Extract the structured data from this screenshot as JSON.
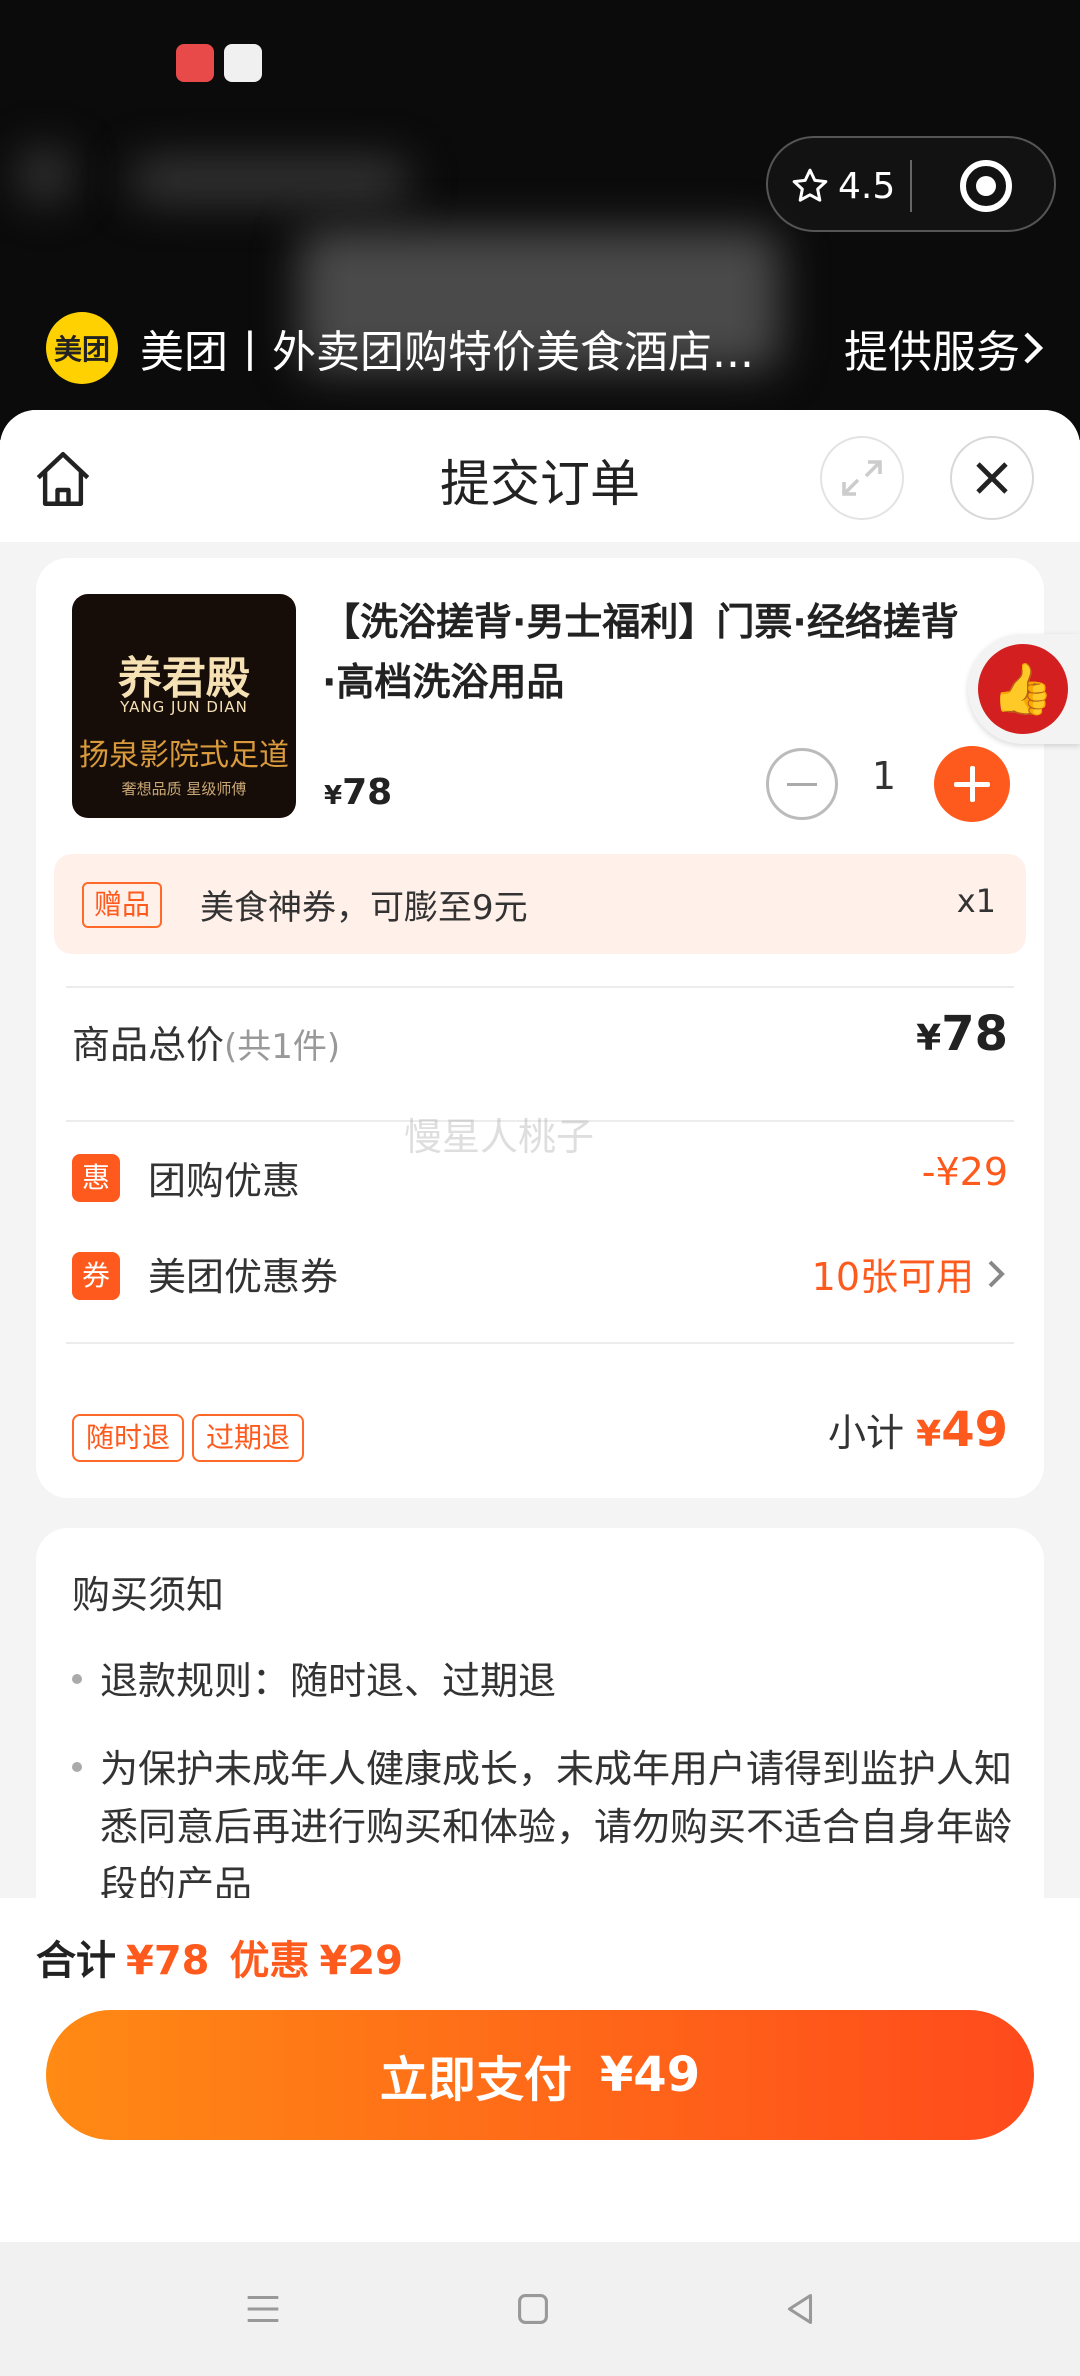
{
  "mini_app": {
    "rating": "4.5",
    "logo_text": "美团",
    "service_name": "美团丨外卖团购特价美食酒店...",
    "service_link": "提供服务"
  },
  "header": {
    "title": "提交订单"
  },
  "product": {
    "image_text_1": "养君殿",
    "image_text_2": "YANG JUN DIAN",
    "image_text_3": "扬泉影院式足道",
    "image_text_4": "奢想品质 星级师傅",
    "title": "【洗浴搓背·男士福利】门票·经络搓背·高档洗浴用品",
    "price_symbol": "¥",
    "price": "78",
    "quantity": "1"
  },
  "gift": {
    "tag": "赠品",
    "text": "美食神券，可膨至9元",
    "count": "x1"
  },
  "totals": {
    "goods_label": "商品总价",
    "goods_sub": "(共1件)",
    "goods_symbol": "¥",
    "goods_value": "78",
    "group_icon": "惠",
    "group_label": "团购优惠",
    "group_value": "-¥29",
    "coupon_icon": "券",
    "coupon_label": "美团优惠券",
    "coupon_value": "10张可用",
    "policy_tags": [
      "随时退",
      "过期退"
    ],
    "subtotal_label": "小计",
    "subtotal_symbol": "¥",
    "subtotal_value": "49"
  },
  "watermark": "慢星人桃子",
  "notice": {
    "title": "购买须知",
    "items": [
      "退款规则：随时退、过期退",
      "为保护未成年人健康成长，未成年用户请得到监护人知悉同意后再进行购买和体验，请勿购买不适合自身年龄段的产品"
    ]
  },
  "bottom": {
    "total_label": "合计",
    "total_value": "¥78",
    "discount_label": "优惠",
    "discount_value": "¥29",
    "pay_label": "立即支付",
    "pay_value": "¥49"
  },
  "colors": {
    "accent": "#ff5a1d",
    "meituan_yellow": "#ffd100"
  }
}
